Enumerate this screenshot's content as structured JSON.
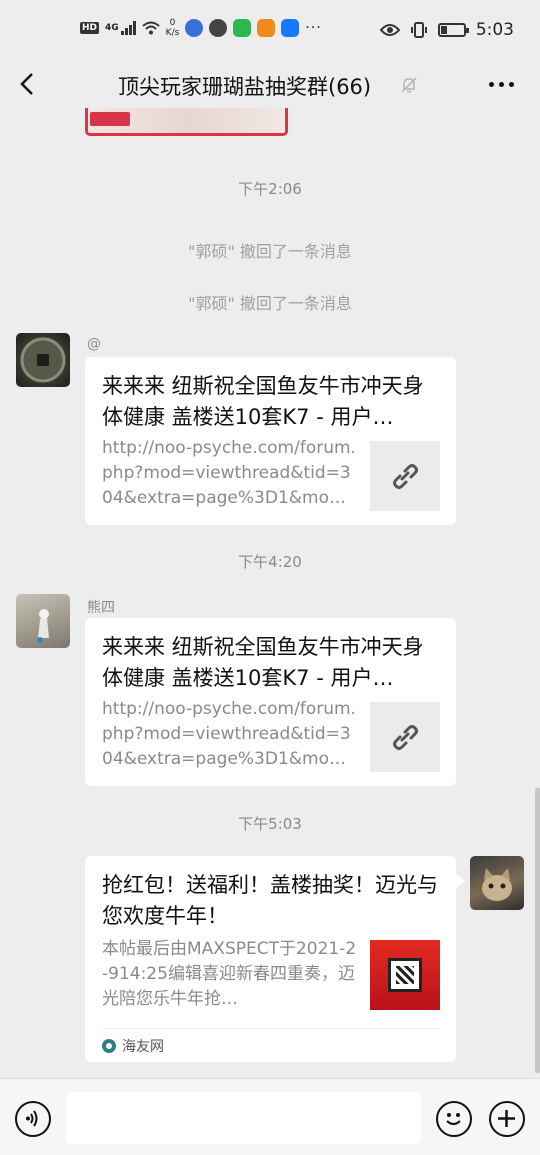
{
  "status_bar": {
    "hd_badge": "HD",
    "network": "4G",
    "speed_value": "0",
    "speed_unit": "K/s",
    "time": "5:03",
    "battery_level": 0.25
  },
  "header": {
    "title": "顶尖玩家珊瑚盐抽奖群(66)"
  },
  "messages": {
    "time1": "下午2:06",
    "recall1": "\"郭硕\" 撤回了一条消息",
    "recall2": "\"郭硕\" 撤回了一条消息",
    "msg1": {
      "sender": "@",
      "title": "来来来 纽斯祝全国鱼友牛市冲天身体健康 盖楼送10套K7 - 用户…",
      "desc": "http://noo-psyche.com/forum.php?mod=viewthread&tid=304&extra=page%3D1&mo…"
    },
    "time2": "下午4:20",
    "msg2": {
      "sender": "熊四",
      "title": "来来来 纽斯祝全国鱼友牛市冲天身体健康 盖楼送10套K7 - 用户…",
      "desc": "http://noo-psyche.com/forum.php?mod=viewthread&tid=304&extra=page%3D1&mo…"
    },
    "time3": "下午5:03",
    "msg3": {
      "title": "抢红包！送福利！盖楼抽奖！迈光与您欢度牛年！",
      "desc": "本帖最后由MAXSPECT于2021-2-914:25编辑喜迎新春四重奏，迈光陪您乐牛年抢…",
      "source": "海友网"
    }
  },
  "colors": {
    "background": "#ededed",
    "card": "#ffffff",
    "time_text": "#8a8a8a",
    "accent_red": "#d9344a"
  }
}
